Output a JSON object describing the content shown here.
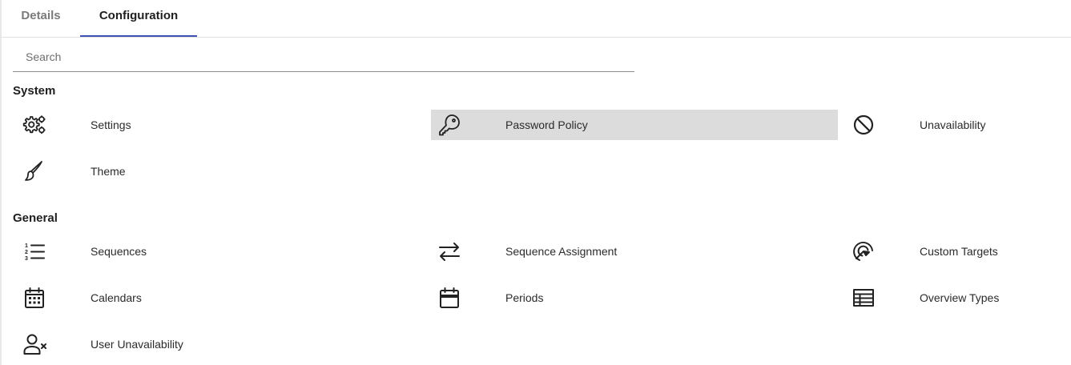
{
  "tabs": [
    {
      "label": "Details"
    },
    {
      "label": "Configuration"
    }
  ],
  "search": {
    "placeholder": "Search",
    "value": ""
  },
  "sections": [
    {
      "title": "System",
      "items": [
        {
          "label": "Settings",
          "icon": "gears-icon"
        },
        {
          "label": "Password Policy",
          "icon": "key-icon",
          "highlighted": true
        },
        {
          "label": "Unavailability",
          "icon": "block-icon"
        },
        {
          "label": "Theme",
          "icon": "brush-icon"
        }
      ]
    },
    {
      "title": "General",
      "items": [
        {
          "label": "Sequences",
          "icon": "numbered-list-icon"
        },
        {
          "label": "Sequence Assignment",
          "icon": "swap-arrows-icon"
        },
        {
          "label": "Custom Targets",
          "icon": "target-icon"
        },
        {
          "label": "Calendars",
          "icon": "calendar-icon"
        },
        {
          "label": "Periods",
          "icon": "calendar-period-icon"
        },
        {
          "label": "Overview Types",
          "icon": "table-icon"
        },
        {
          "label": "User Unavailability",
          "icon": "user-remove-icon"
        }
      ]
    }
  ],
  "colors": {
    "accent": "#3f51b5",
    "highlight": "#dcdcdc"
  }
}
